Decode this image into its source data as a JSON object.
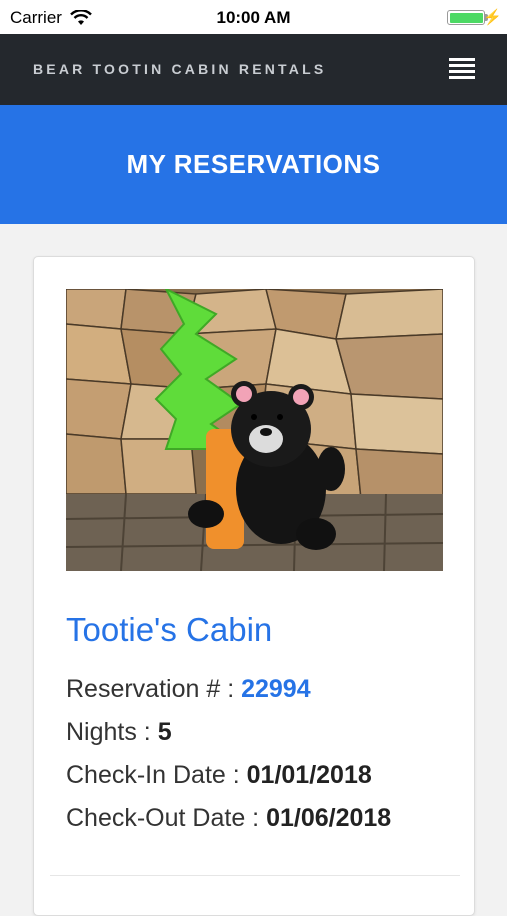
{
  "status_bar": {
    "carrier": "Carrier",
    "time": "10:00 AM",
    "battery_level": 1.0,
    "battery_color": "#4cd964"
  },
  "navbar": {
    "brand": "BEAR TOOTIN CABIN RENTALS",
    "menu_icon": "hamburger-menu-icon"
  },
  "banner": {
    "title": "MY RESERVATIONS"
  },
  "reservation": {
    "cabin_name": "Tootie's Cabin",
    "reservation_label": "Reservation # : ",
    "reservation_number": "22994",
    "nights_label": "Nights : ",
    "nights": "5",
    "checkin_label": "Check-In Date : ",
    "checkin_date": "01/01/2018",
    "checkout_label": "Check-Out Date : ",
    "checkout_date": "01/06/2018"
  },
  "colors": {
    "navbar": "#24282d",
    "accent": "#2673e6",
    "background": "#f2f2f2"
  }
}
